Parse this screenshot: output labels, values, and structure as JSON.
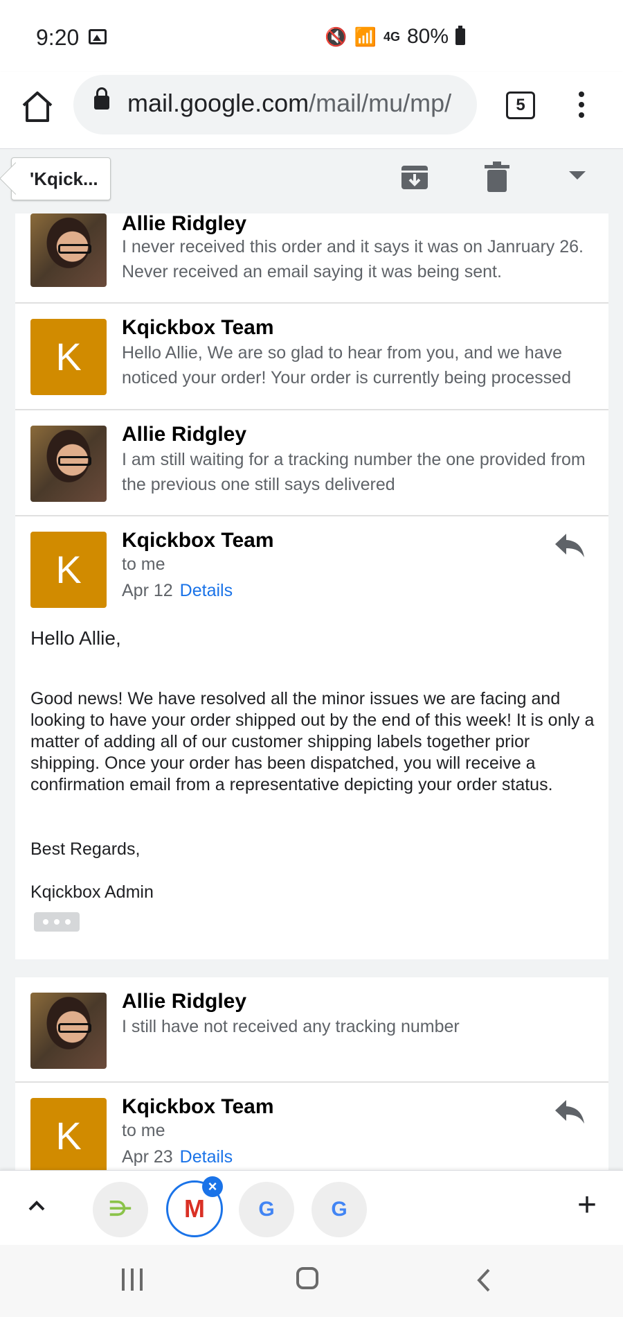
{
  "status_bar": {
    "time": "9:20",
    "network": "4G",
    "battery": "80%"
  },
  "browser": {
    "url_domain": "mail.google.com",
    "url_path": "/mail/mu/mp/",
    "tab_count": "5"
  },
  "gmail_header": {
    "back_label": "'Kqick..."
  },
  "thread": {
    "messages": [
      {
        "sender": "Allie Ridgley",
        "snippet": "I never received this order and it says it was on Janruary 26. Never received an email saying it was being sent."
      },
      {
        "sender": "Kqickbox Team",
        "avatar_letter": "K",
        "snippet": "Hello Allie, We are so glad to hear from you, and we have noticed your order! Your order is currently being processed"
      },
      {
        "sender": "Allie Ridgley",
        "snippet": "I am still waiting for a tracking number the one provided from the previous one still says delivered"
      },
      {
        "sender": "Kqickbox Team",
        "avatar_letter": "K",
        "to": "to me",
        "date": "Apr 12",
        "details_label": "Details",
        "greeting": "Hello Allie,",
        "body": "Good news! We have resolved all the minor issues we are facing and looking to have your order shipped out by the end of this week! It is only a matter of adding all of our customer shipping labels together prior shipping. Once your order has been dispatched, you will receive a confirmation email from a representative depicting your order status.",
        "closing": "Best Regards,",
        "signature": "Kqickbox Admin"
      },
      {
        "sender": "Allie Ridgley",
        "snippet": "I still have not received any tracking number"
      },
      {
        "sender": "Kqickbox Team",
        "avatar_letter": "K",
        "to": "to me",
        "date": "Apr 23",
        "details_label": "Details"
      }
    ]
  },
  "tab_strip": {
    "tabs": [
      {
        "icon": "leaf-favicon-icon",
        "glyph": "⋺"
      },
      {
        "icon": "gmail-favicon-icon",
        "glyph": "M"
      },
      {
        "icon": "google-favicon-icon",
        "glyph": "G"
      },
      {
        "icon": "google-favicon-icon",
        "glyph": "G"
      }
    ],
    "new_tab_glyph": "+",
    "close_glyph": "×"
  },
  "colors": {
    "kqickbox_avatar": "#d18b00",
    "link_blue": "#1a73e8",
    "thread_background": "#f1f3f4"
  }
}
